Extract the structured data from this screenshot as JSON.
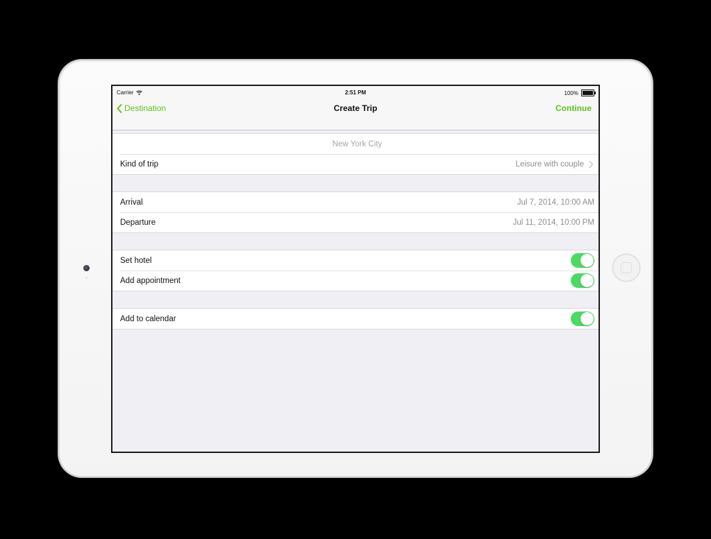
{
  "statusbar": {
    "carrier": "Carrier",
    "wifi_icon": "wifi-icon",
    "time": "2:51 PM",
    "battery_percent": "100%",
    "battery_icon": "battery-icon",
    "battery_level": 1.0
  },
  "navbar": {
    "back_label": "Destination",
    "back_icon": "chevron-left-icon",
    "title": "Create Trip",
    "action_label": "Continue",
    "accent_color": "#5cc41a"
  },
  "trip": {
    "destination_placeholder": "New York City",
    "kind_label": "Kind of trip",
    "kind_value": "Leisure with couple",
    "kind_icon": "chevron-right-icon"
  },
  "dates": {
    "arrival_label": "Arrival",
    "arrival_value": "Jul 7, 2014, 10:00 AM",
    "departure_label": "Departure",
    "departure_value": "Jul 11, 2014, 10:00 PM"
  },
  "options": {
    "set_hotel_label": "Set hotel",
    "set_hotel_on": true,
    "add_appointment_label": "Add appointment",
    "add_appointment_on": true,
    "toggle_color": "#4cd964"
  },
  "calendar": {
    "add_to_calendar_label": "Add to calendar",
    "add_to_calendar_on": true
  }
}
